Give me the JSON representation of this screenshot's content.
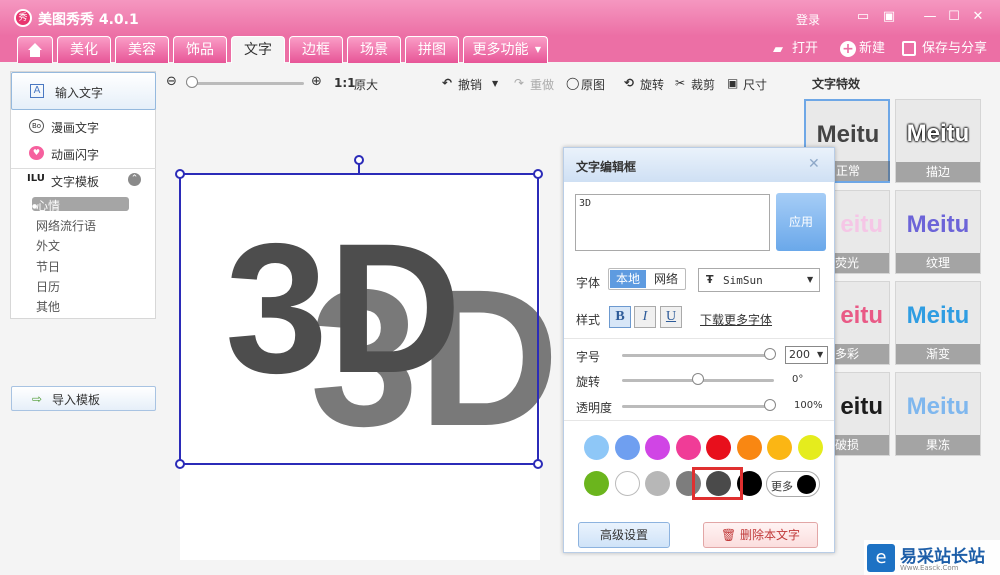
{
  "app": {
    "title": "美图秀秀 4.0.1",
    "login": "登录"
  },
  "tabs": [
    "美化",
    "美容",
    "饰品",
    "文字",
    "边框",
    "场景",
    "拼图",
    "更多功能"
  ],
  "top_actions": {
    "open": "打开",
    "new": "新建",
    "save": "保存与分享"
  },
  "left_panel": {
    "input_text": "输入文字",
    "comic_text": "漫画文字",
    "animated_text": "动画闪字",
    "template": "文字模板",
    "subs": [
      "心情",
      "网络流行语",
      "外文",
      "节日",
      "日历",
      "其他"
    ],
    "import": "导入模板"
  },
  "toolbar": {
    "zoom_1to1": "1:1",
    "original_size": "原大",
    "undo": "撤销",
    "redo": "重做",
    "original": "原图",
    "rotate": "旋转",
    "crop": "裁剪",
    "size": "尺寸"
  },
  "canvas": {
    "text": "3D"
  },
  "effects": {
    "title": "文字特效",
    "items": [
      {
        "label": "正常",
        "word": "Meitu",
        "color": "#444444"
      },
      {
        "label": "描边",
        "word": "Meitu",
        "color": "#000000"
      },
      {
        "label": "荧光",
        "word": "eitu",
        "color": "#f5c6e6"
      },
      {
        "label": "纹理",
        "word": "Meitu",
        "color": "#6c64d8"
      },
      {
        "label": "多彩",
        "word": "eitu",
        "color": "#e95a86"
      },
      {
        "label": "渐变",
        "word": "Meitu",
        "color": "#2f9de2"
      },
      {
        "label": "破损",
        "word": "eitu",
        "color": "#1c1c1c"
      },
      {
        "label": "果冻",
        "word": "Meitu",
        "color": "#7fb7ee"
      }
    ]
  },
  "editor": {
    "title": "文字编辑框",
    "text_value": "3D",
    "apply": "应用",
    "font_label": "字体",
    "font_local": "本地",
    "font_net": "网络",
    "font_name": "SimSun",
    "style_label": "样式",
    "style_b": "B",
    "style_i": "I",
    "style_u": "U",
    "download_fonts": "下载更多字体",
    "size_label": "字号",
    "size_value": "200",
    "rotate_label": "旋转",
    "rotate_value": "0°",
    "opacity_label": "透明度",
    "opacity_value": "100%",
    "more": "更多",
    "advanced": "高级设置",
    "delete": "删除本文字",
    "sliders": {
      "size": 1.0,
      "rotate": 0.5,
      "opacity": 1.0
    }
  },
  "colors": [
    "#8ec7f7",
    "#6f9ff0",
    "#d045e5",
    "#f03c97",
    "#e80f1c",
    "#f98712",
    "#fbb614",
    "#e5ec1d",
    "#6bb51d",
    "#ffffff",
    "#b7b7b7",
    "#7d7d7d",
    "#4a4a4a",
    "#000000"
  ],
  "watermark": {
    "text": "易采站长站",
    "sub": "Www.Easck.Com"
  }
}
